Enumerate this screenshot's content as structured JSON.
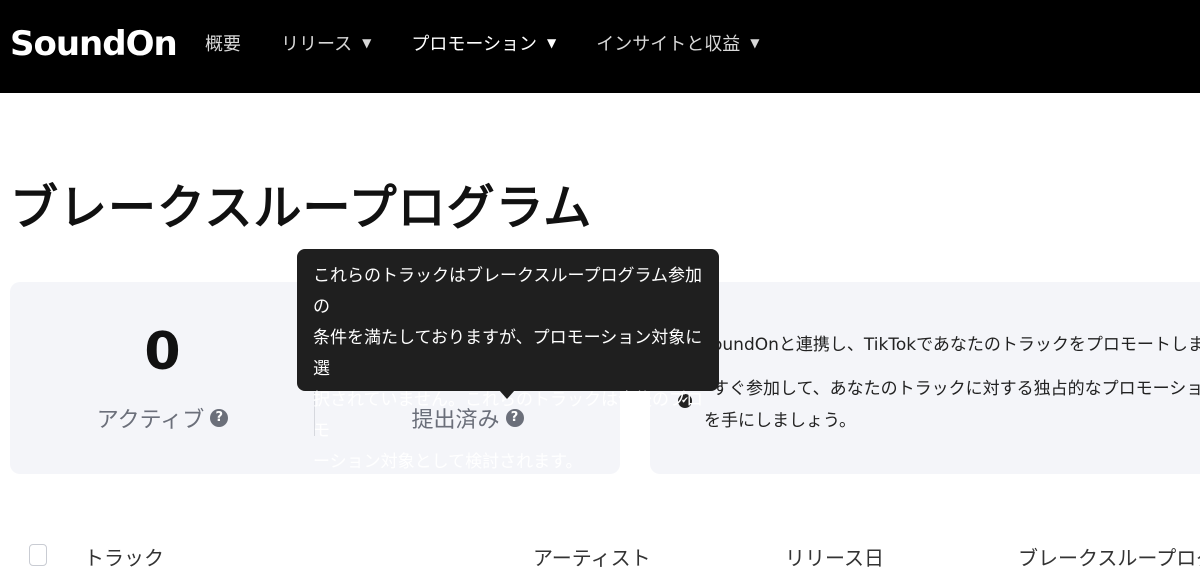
{
  "brand": {
    "logo_text": "SoundOn"
  },
  "nav": {
    "items": [
      {
        "label": "概要",
        "has_caret": false
      },
      {
        "label": "リリース",
        "has_caret": true
      },
      {
        "label": "プロモーション",
        "has_caret": true
      },
      {
        "label": "インサイトと収益",
        "has_caret": true
      }
    ],
    "caret_glyph": "▼",
    "active_index": 2
  },
  "page": {
    "title": "ブレークスループログラム"
  },
  "stats": [
    {
      "value": "0",
      "label": "アクティブ"
    },
    {
      "value": "",
      "label": "提出済み"
    }
  ],
  "help_glyph": "?",
  "tooltip": {
    "lines": [
      "これらのトラックはブレークスループログラム参加の",
      "条件を満たしておりますが、プロモーション対象に選",
      "択されていません。これらのトラックは今後のプロモ",
      "ーション対象として検討されます。"
    ]
  },
  "info": {
    "line1": "oundOnと連携し、TikTokであなたのトラックをプロモートしまし",
    "line2": "すぐ参加して、あなたのトラックに対する独占的なプロモーション",
    "line3": "を手にしましょう。"
  },
  "table": {
    "columns": [
      "トラック",
      "アーティスト",
      "リリース日",
      "ブレークスループログラ"
    ]
  },
  "colors": {
    "topbar": "#000000",
    "card_bg": "#f4f5f9",
    "tooltip_bg": "#1f1f1f"
  }
}
